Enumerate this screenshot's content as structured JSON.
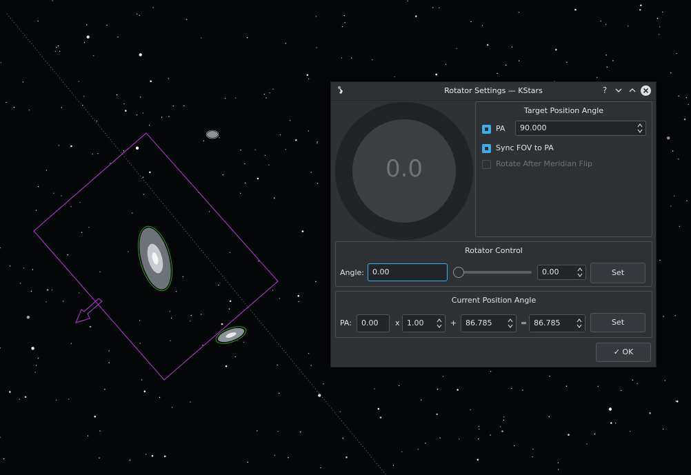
{
  "window": {
    "title": "Rotator Settings — KStars",
    "help_glyph": "?",
    "minimize_glyph": "⌄",
    "maximize_glyph": "⌃",
    "close_glyph": "✕"
  },
  "dial": {
    "value": "0.0"
  },
  "target_position_angle": {
    "title": "Target Position Angle",
    "pa_label": "PA",
    "pa_value": "90.000",
    "pa_checked": true,
    "sync_label": "Sync FOV to PA",
    "sync_checked": true,
    "meridian_label": "Rotate After Meridian Flip",
    "meridian_checked": false,
    "meridian_enabled": false
  },
  "rotator_control": {
    "title": "Rotator Control",
    "angle_label": "Angle:",
    "angle_value": "0.00",
    "slider_value": 0,
    "spin_value": "0.00",
    "set_label": "Set"
  },
  "current_position_angle": {
    "title": "Current Position Angle",
    "pa_label": "PA:",
    "pa_value": "0.00",
    "times_sign": "x",
    "multiplier_value": "1.00",
    "plus_sign": "+",
    "offset_value": "86.785",
    "equals_sign": "=",
    "result_value": "86.785",
    "set_label": "Set"
  },
  "ok_button": {
    "check": "✓",
    "label": "OK"
  },
  "icons": {
    "app_icon": "kstars-icon",
    "spin_up": "▲",
    "spin_down": "▼"
  },
  "colors": {
    "accent": "#3daee9",
    "fov_outline": "#a030c0",
    "galaxy_outline": "#2a9a2a"
  }
}
